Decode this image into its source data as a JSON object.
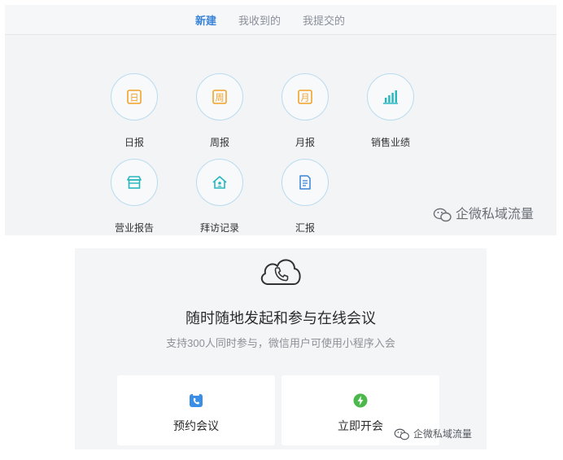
{
  "tabs": [
    {
      "label": "新建",
      "active": true
    },
    {
      "label": "我收到的",
      "active": false
    },
    {
      "label": "我提交的",
      "active": false
    }
  ],
  "report_tiles": [
    {
      "label": "日报",
      "icon": "daily-report-icon",
      "glyph": "日",
      "color": "#f2a22a"
    },
    {
      "label": "周报",
      "icon": "weekly-report-icon",
      "glyph": "周",
      "color": "#f2a22a"
    },
    {
      "label": "月报",
      "icon": "monthly-report-icon",
      "glyph": "月",
      "color": "#f2a22a"
    },
    {
      "label": "销售业绩",
      "icon": "bar-chart-icon",
      "color": "#26b7bd"
    },
    {
      "label": "营业报告",
      "icon": "store-icon",
      "color": "#26b7bd"
    },
    {
      "label": "拜访记录",
      "icon": "house-visit-icon",
      "color": "#26b7bd"
    },
    {
      "label": "汇报",
      "icon": "document-icon",
      "color": "#3a84d8"
    }
  ],
  "watermark": "企微私域流量",
  "meeting": {
    "icon": "cloud-phone-icon",
    "headline": "随时随地发起和参与在线会议",
    "subline": "支持300人同时参与，微信用户可使用小程序入会",
    "schedule_label": "预约会议",
    "start_label": "立即开会",
    "schedule_color": "#3a8ee6",
    "start_color": "#4cb84c"
  }
}
